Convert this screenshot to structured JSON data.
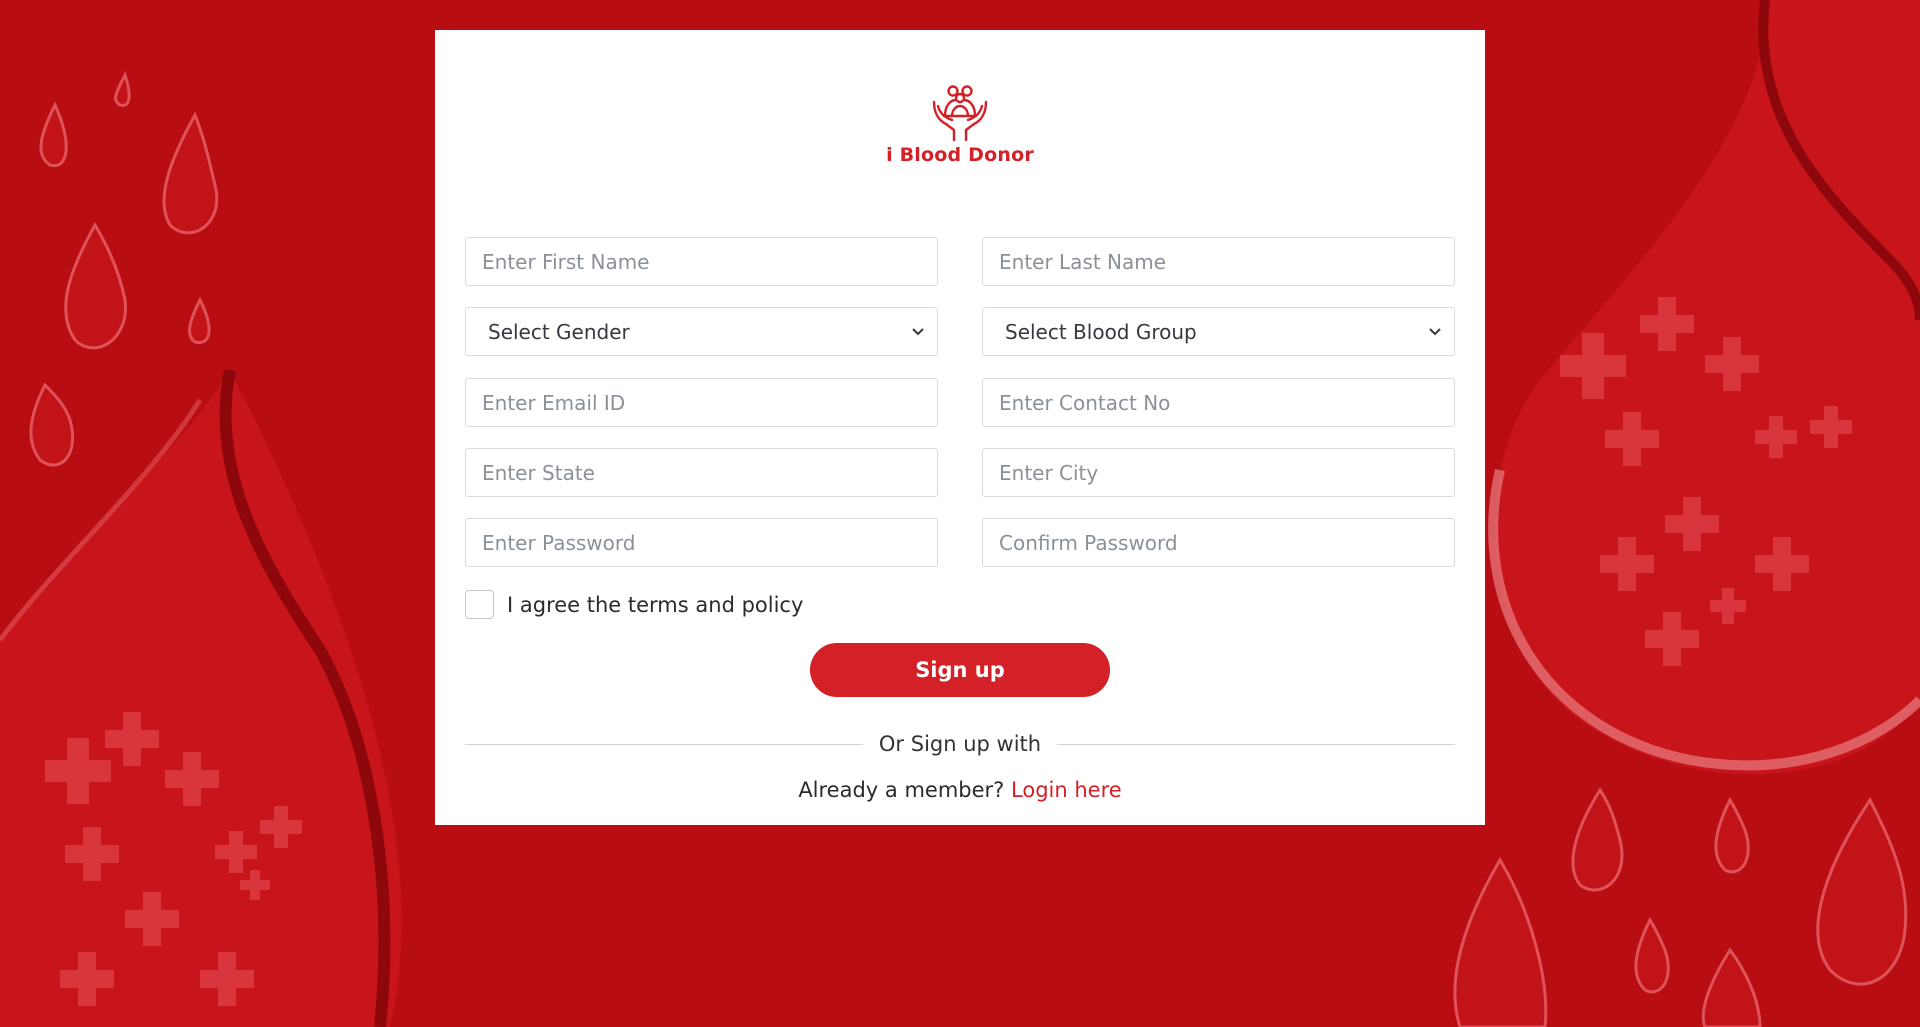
{
  "brand": {
    "name": "i Blood Donor",
    "logo_icon": "hands-holding-family-icon",
    "color": "#d42027"
  },
  "colors": {
    "background": "#b80d12",
    "accent": "#d42027",
    "card": "#ffffff"
  },
  "form": {
    "first_name": {
      "placeholder": "Enter First Name",
      "value": ""
    },
    "last_name": {
      "placeholder": "Enter Last Name",
      "value": ""
    },
    "gender": {
      "selected": "Select Gender"
    },
    "blood_group": {
      "selected": "Select Blood Group"
    },
    "email": {
      "placeholder": "Enter Email ID",
      "value": ""
    },
    "contact": {
      "placeholder": "Enter Contact No",
      "value": ""
    },
    "state": {
      "placeholder": "Enter State",
      "value": ""
    },
    "city": {
      "placeholder": "Enter City",
      "value": ""
    },
    "password": {
      "placeholder": "Enter Password",
      "value": ""
    },
    "confirm_password": {
      "placeholder": "Confirm Password",
      "value": ""
    },
    "agree_label": "I agree the terms and policy",
    "agree_checked": false,
    "signup_label": "Sign up",
    "alt_signup_text": "Or Sign up with",
    "member_text": "Already a member?",
    "login_link": "Login here"
  }
}
